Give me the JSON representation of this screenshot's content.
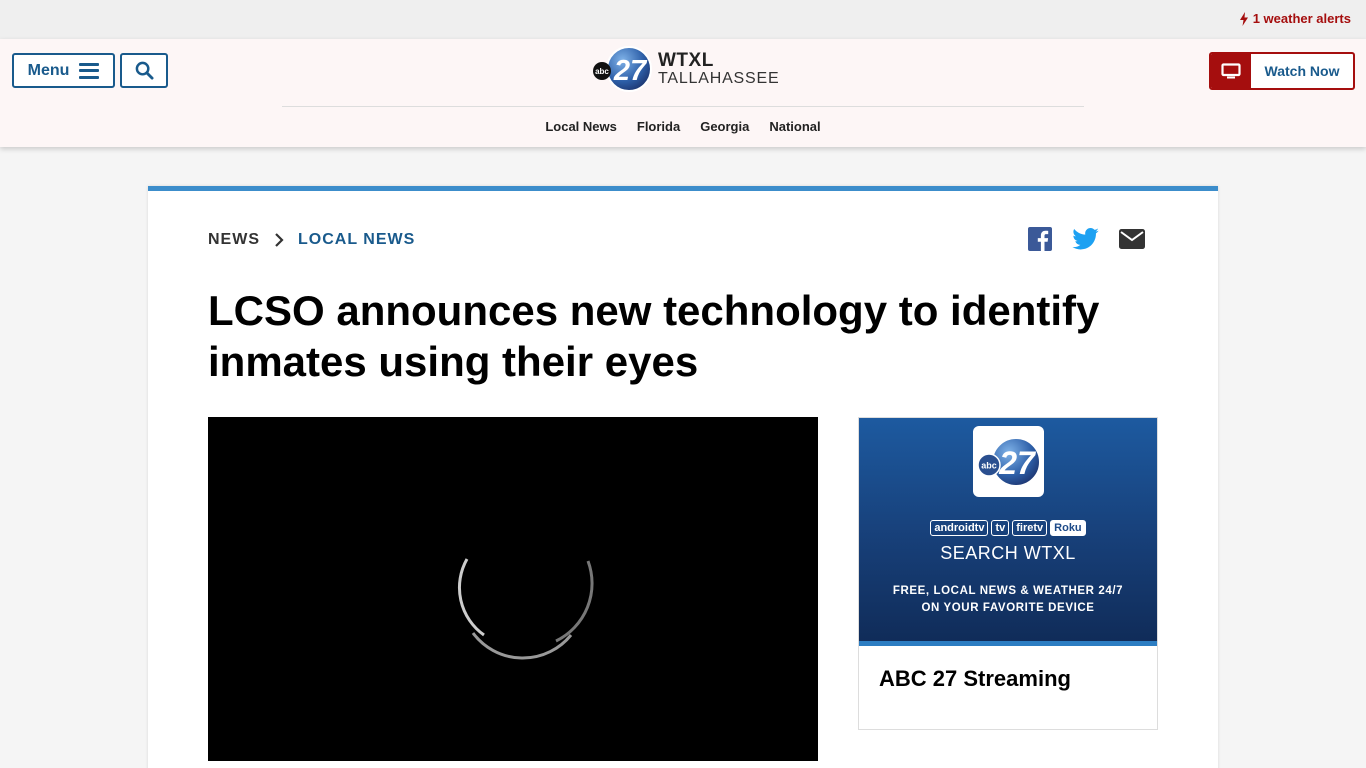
{
  "alerts": {
    "text": "1 weather alerts",
    "color": "#a50e0e"
  },
  "header": {
    "menu_label": "Menu",
    "search_icon": "search-icon",
    "logo": {
      "mark": "abc 27",
      "station": "WTXL",
      "city": "TALLAHASSEE"
    },
    "nav": [
      "Local News",
      "Florida",
      "Georgia",
      "National"
    ],
    "watch_label": "Watch Now",
    "accent_color": "#195a8c"
  },
  "article": {
    "breadcrumb": [
      "NEWS",
      "LOCAL NEWS"
    ],
    "share_icons": [
      "facebook-icon",
      "twitter-icon",
      "email-icon"
    ],
    "headline": "LCSO announces new technology to identify inmates using their eyes",
    "video": {
      "state": "loading"
    }
  },
  "promo": {
    "logo_mark": "abc 27",
    "platforms": [
      "androidtv",
      "tv",
      "firetv",
      "Roku"
    ],
    "search_text": "SEARCH WTXL",
    "tagline_1": "FREE, LOCAL NEWS & WEATHER 24/7",
    "tagline_2": "ON YOUR FAVORITE DEVICE",
    "title": "ABC 27 Streaming"
  }
}
